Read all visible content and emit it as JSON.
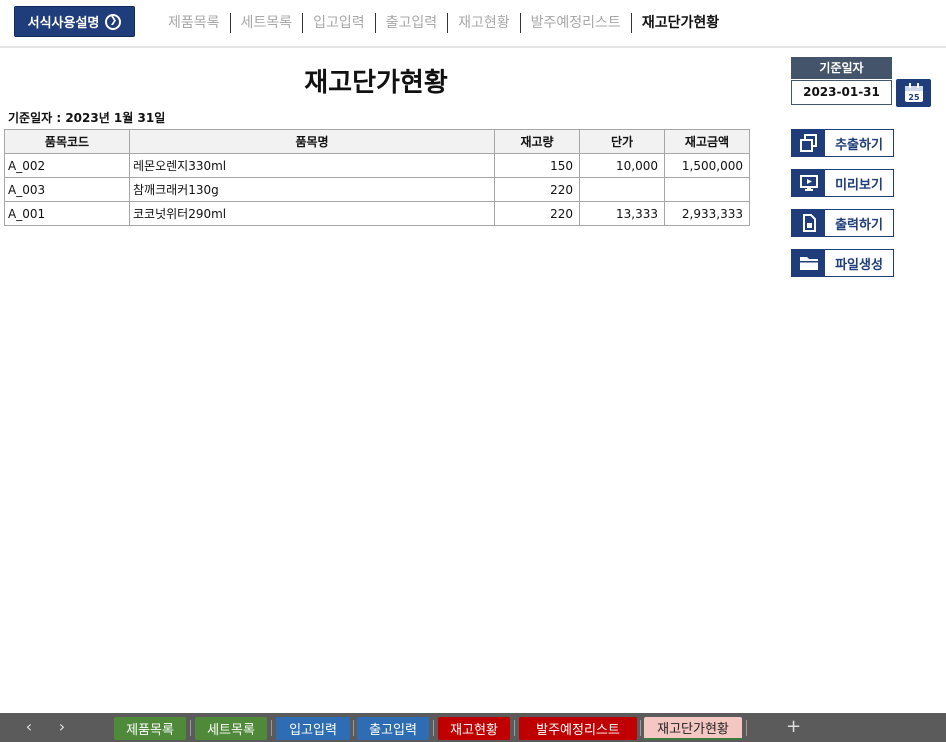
{
  "top": {
    "guide_button": "서식사용설명",
    "nav": [
      {
        "label": "제품목록",
        "active": false
      },
      {
        "label": "세트목록",
        "active": false
      },
      {
        "label": "입고입력",
        "active": false
      },
      {
        "label": "출고입력",
        "active": false
      },
      {
        "label": "재고현황",
        "active": false
      },
      {
        "label": "발주예정리스트",
        "active": false
      },
      {
        "label": "재고단가현황",
        "active": true
      }
    ]
  },
  "report": {
    "title": "재고단가현황",
    "date_line": "기준일자 : 2023년 1월 31일",
    "columns": [
      "품목코드",
      "품목명",
      "재고량",
      "단가",
      "재고금액"
    ],
    "rows": [
      {
        "code": "A_002",
        "name": "레몬오렌지330ml",
        "qty": "150",
        "price": "10,000",
        "amount": "1,500,000"
      },
      {
        "code": "A_003",
        "name": "참깨크래커130g",
        "qty": "220",
        "price": "",
        "amount": ""
      },
      {
        "code": "A_001",
        "name": "코코넛위터290ml",
        "qty": "220",
        "price": "13,333",
        "amount": "2,933,333"
      }
    ]
  },
  "panel": {
    "date_label": "기준일자",
    "date_value": "2023-01-31",
    "calendar_day": "25",
    "buttons": {
      "extract": "추출하기",
      "preview": "미리보기",
      "print": "출력하기",
      "file": "파일생성"
    }
  },
  "sheets": {
    "tabs": [
      {
        "label": "제품목록",
        "color": "#4e8a3a"
      },
      {
        "label": "세트목록",
        "color": "#4e8a3a"
      },
      {
        "label": "입고입력",
        "color": "#2e6db4"
      },
      {
        "label": "출고입력",
        "color": "#2e6db4"
      },
      {
        "label": "재고현황",
        "color": "#c00000"
      },
      {
        "label": "발주예정리스트",
        "color": "#c00000"
      },
      {
        "label": "재고단가현황",
        "color": "#f4c7c3"
      }
    ],
    "add": "+"
  }
}
